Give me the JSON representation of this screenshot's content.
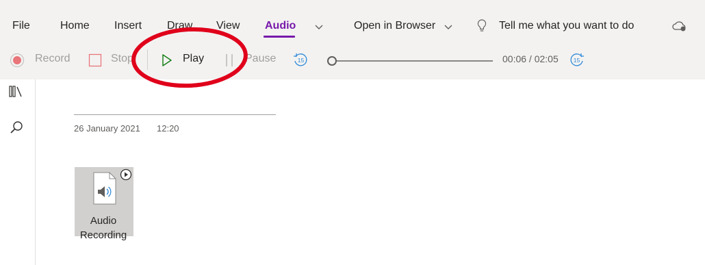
{
  "menu": {
    "file": "File",
    "home": "Home",
    "insert": "Insert",
    "draw": "Draw",
    "view": "View",
    "audio": "Audio",
    "open_in_browser": "Open in Browser",
    "tell_me": "Tell me what you want to do"
  },
  "toolbar": {
    "record": "Record",
    "stop": "Stop",
    "play": "Play",
    "pause": "Pause",
    "time": "00:06 / 02:05",
    "skip_seconds": "15",
    "progress_fraction": 0.05
  },
  "page": {
    "date": "26 January 2021",
    "time": "12:20",
    "attachment_label": "Audio Recording"
  },
  "colors": {
    "accent": "#7719aa",
    "annotation": "#e0001b",
    "record": "#e8757a",
    "play": "#107c10"
  },
  "icons": {
    "lightbulb": "lightbulb-icon",
    "cloud": "cloud-sync-icon",
    "notebooks": "notebooks-icon",
    "search": "search-icon"
  }
}
